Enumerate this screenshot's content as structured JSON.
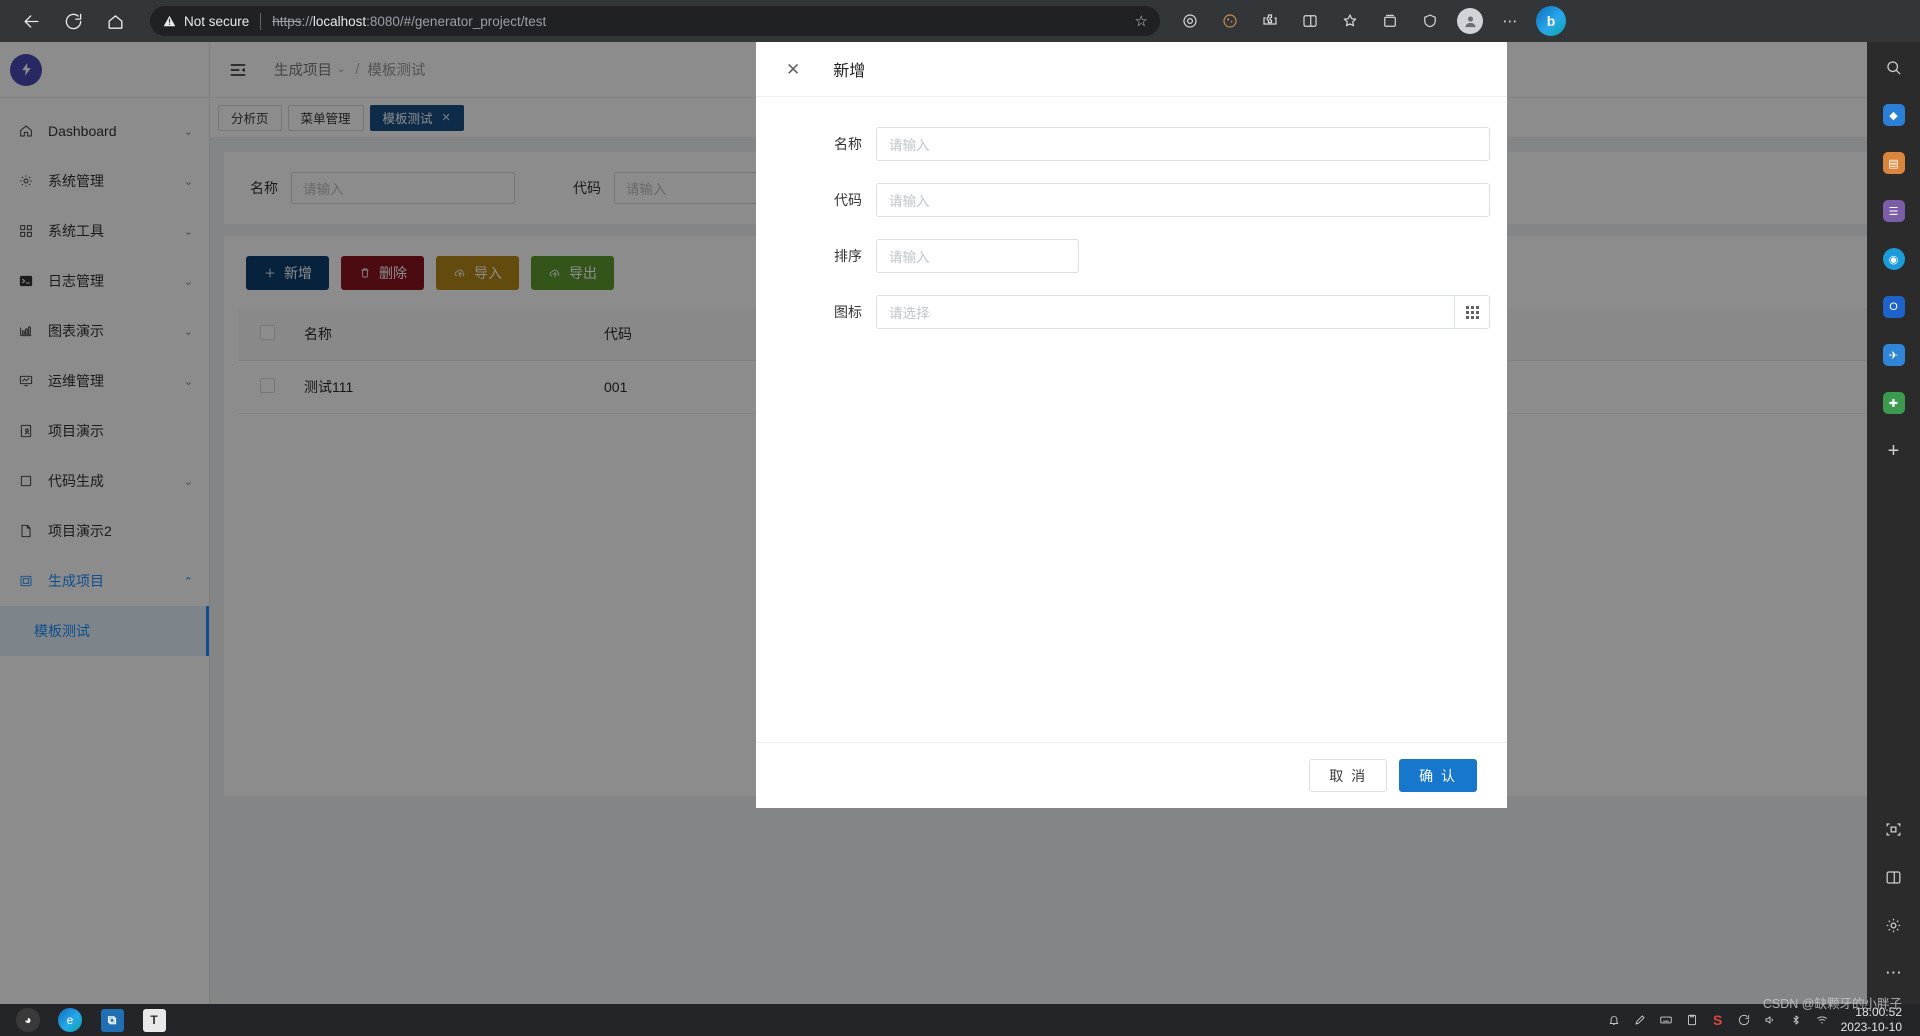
{
  "browser": {
    "back_icon": "back-arrow-icon",
    "reload_icon": "reload-icon",
    "home_icon": "home-icon",
    "security_label": "Not secure",
    "url_scheme": "https",
    "url_rest": "://localhost:8080/#/generator_project/test",
    "url_host": "localhost",
    "url_full": "https://localhost:8080/#/generator_project/test",
    "star_icon": "bookmark-star-icon",
    "profile_icon": "profile-avatar-icon",
    "menu_icon": "more-options-icon",
    "edge_logo": "edge-copilot-icon"
  },
  "sidebar": {
    "logo": "app-logo",
    "items": [
      {
        "label": "Dashboard",
        "icon": "home-icon",
        "expandable": true,
        "state": "collapsed"
      },
      {
        "label": "系统管理",
        "icon": "gear-icon",
        "expandable": true,
        "state": "collapsed"
      },
      {
        "label": "系统工具",
        "icon": "grid-blocks-icon",
        "expandable": true,
        "state": "collapsed"
      },
      {
        "label": "日志管理",
        "icon": "terminal-icon",
        "expandable": true,
        "state": "collapsed"
      },
      {
        "label": "图表演示",
        "icon": "bar-chart-icon",
        "expandable": true,
        "state": "collapsed"
      },
      {
        "label": "运维管理",
        "icon": "monitor-chart-icon",
        "expandable": true,
        "state": "collapsed"
      },
      {
        "label": "项目演示",
        "icon": "document-user-icon",
        "expandable": false,
        "state": "none"
      },
      {
        "label": "代码生成",
        "icon": "square-icon",
        "expandable": true,
        "state": "collapsed"
      },
      {
        "label": "项目演示2",
        "icon": "file-icon",
        "expandable": false,
        "state": "none"
      },
      {
        "label": "生成项目",
        "icon": "window-icon",
        "expandable": true,
        "state": "expanded"
      }
    ],
    "submenu": {
      "label": "模板测试",
      "icon": "file-icon",
      "active": true
    },
    "active_color": "#1890ff"
  },
  "topbar": {
    "collapse_icon": "menu-collapse-icon",
    "breadcrumb": {
      "first": "生成项目",
      "chevron": "chevron-down-icon",
      "separator": "/",
      "last": "模板测试"
    }
  },
  "tabs": [
    {
      "label": "分析页",
      "active": false,
      "closable": false
    },
    {
      "label": "菜单管理",
      "active": false,
      "closable": false
    },
    {
      "label": "模板测试",
      "active": true,
      "closable": true,
      "close_icon": "close-icon"
    }
  ],
  "search": {
    "fields": [
      {
        "label": "名称",
        "placeholder": "请输入",
        "value": ""
      },
      {
        "label": "代码",
        "placeholder": "请输入",
        "value": ""
      }
    ]
  },
  "toolbar": {
    "buttons": [
      {
        "label": "新增",
        "icon": "plus-icon",
        "color": "#0b3e6f"
      },
      {
        "label": "删除",
        "icon": "trash-icon",
        "color": "#8a1420"
      },
      {
        "label": "导入",
        "icon": "upload-cloud-icon",
        "color": "#b4891b"
      },
      {
        "label": "导出",
        "icon": "upload-cloud-icon",
        "color": "#5f9b2e"
      }
    ]
  },
  "table": {
    "select_all_checkbox": "select-all-checkbox",
    "columns": [
      "名称",
      "代码"
    ],
    "rows": [
      {
        "checked": false,
        "名称": "测试111",
        "代码": "001"
      }
    ]
  },
  "modal": {
    "close_icon": "close-icon",
    "title": "新增",
    "fields": [
      {
        "label": "名称",
        "placeholder": "请输入",
        "value": "",
        "width": "wide"
      },
      {
        "label": "代码",
        "placeholder": "请输入",
        "value": "",
        "width": "wide"
      },
      {
        "label": "排序",
        "placeholder": "请输入",
        "value": "",
        "width": "narrow"
      },
      {
        "label": "图标",
        "placeholder": "请选择",
        "value": "",
        "width": "icon",
        "picker_icon": "grid-picker-icon"
      }
    ],
    "cancel_label": "取 消",
    "confirm_label": "确 认",
    "confirm_color": "#1677cc"
  },
  "rail": {
    "icons": [
      {
        "name": "search-icon",
        "glyph": "⌕",
        "color": "#cfcfcf",
        "bg": "transparent"
      },
      {
        "name": "shopping-bag-icon",
        "glyph": "",
        "color": "#fff",
        "bg": "#2b7fd4"
      },
      {
        "name": "briefcase-icon",
        "glyph": "",
        "color": "#fff",
        "bg": "#d9853b"
      },
      {
        "name": "people-icon",
        "glyph": "",
        "color": "#fff",
        "bg": "#7b5ea7"
      },
      {
        "name": "games-icon",
        "glyph": "",
        "color": "#fff",
        "bg": "#1b9bd8"
      },
      {
        "name": "outlook-icon",
        "glyph": "",
        "color": "#fff",
        "bg": "#1d63c9"
      },
      {
        "name": "mail-icon",
        "glyph": "",
        "color": "#fff",
        "bg": "#2f86d6"
      },
      {
        "name": "tools-icon",
        "glyph": "",
        "color": "#fff",
        "bg": "#3c9a4e"
      },
      {
        "name": "add-icon",
        "glyph": "+",
        "color": "#cfcfcf",
        "bg": "transparent"
      },
      {
        "name": "screenshot-icon",
        "glyph": "",
        "color": "#cfcfcf",
        "bg": "transparent"
      },
      {
        "name": "split-screen-icon",
        "glyph": "",
        "color": "#cfcfcf",
        "bg": "transparent"
      },
      {
        "name": "settings-icon",
        "glyph": "",
        "color": "#cfcfcf",
        "bg": "transparent"
      },
      {
        "name": "more-icon",
        "glyph": "⋯",
        "color": "#cfcfcf",
        "bg": "transparent"
      }
    ]
  },
  "taskbar": {
    "apps": [
      {
        "name": "start-orb",
        "color": "#1f1f1f"
      },
      {
        "name": "edge-browser",
        "color": "#1b8fd8"
      },
      {
        "name": "vscode",
        "color": "#1f6fb2"
      },
      {
        "name": "typora",
        "color": "#e8e8e8"
      }
    ],
    "tray": [
      {
        "name": "bell-icon"
      },
      {
        "name": "pen-icon"
      },
      {
        "name": "keyboard-icon"
      },
      {
        "name": "clipboard-icon"
      },
      {
        "name": "snipaste-icon"
      },
      {
        "name": "sync-icon"
      },
      {
        "name": "volume-icon"
      },
      {
        "name": "bluetooth-icon"
      },
      {
        "name": "wifi-icon"
      }
    ],
    "time": "18:00:52",
    "date": "2023-10-10"
  },
  "watermark": "CSDN @缺颗牙的小胖子"
}
